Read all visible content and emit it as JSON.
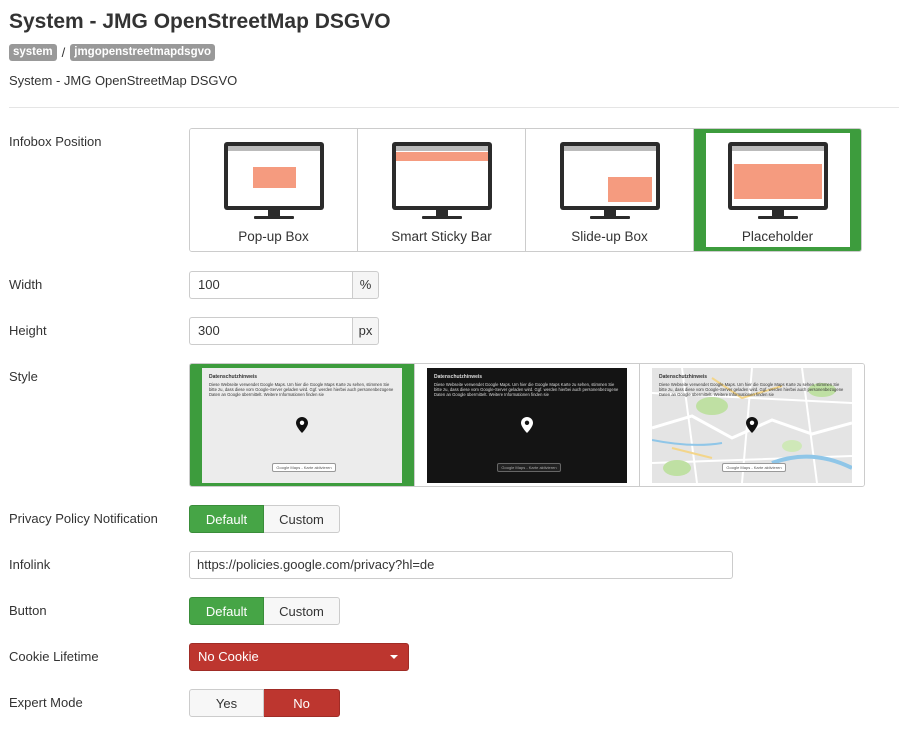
{
  "header": {
    "title": "System - JMG OpenStreetMap DSGVO",
    "breadcrumb": [
      "system",
      "jmgopenstreetmapdsgvo"
    ],
    "breadcrumb_separator": "/",
    "subtitle": "System - JMG OpenStreetMap DSGVO"
  },
  "fields": {
    "infobox_position": {
      "label": "Infobox Position",
      "options": [
        "Pop-up Box",
        "Smart Sticky Bar",
        "Slide-up Box",
        "Placeholder"
      ],
      "selected": "Placeholder"
    },
    "width": {
      "label": "Width",
      "value": "100",
      "unit": "%"
    },
    "height": {
      "label": "Height",
      "value": "300",
      "unit": "px"
    },
    "style": {
      "label": "Style",
      "selected": "light",
      "preview": {
        "title": "Datenschutzhinweis",
        "text": "Diese Webseite verwendet Google Maps. Um hier die Google Maps Karte zu sehen, stimmen Sie bitte zu, dass diese vom Google-Server geladen wird. Ggf. werden hierbei auch personenbezogene Daten an Google übermittelt. Weitere Informationen finden sie",
        "button": "Google Maps - Karte aktivieren"
      }
    },
    "privacy_notification": {
      "label": "Privacy Policy Notification",
      "options": [
        "Default",
        "Custom"
      ],
      "selected": "Default"
    },
    "infolink": {
      "label": "Infolink",
      "value": "https://policies.google.com/privacy?hl=de"
    },
    "button": {
      "label": "Button",
      "options": [
        "Default",
        "Custom"
      ],
      "selected": "Default"
    },
    "cookie_lifetime": {
      "label": "Cookie Lifetime",
      "value": "No Cookie"
    },
    "expert_mode": {
      "label": "Expert Mode",
      "options": [
        "Yes",
        "No"
      ],
      "selected": "No"
    }
  },
  "colors": {
    "selected_green": "#46a546",
    "danger_red": "#bd362f",
    "preview_salmon": "#f59b7f"
  }
}
